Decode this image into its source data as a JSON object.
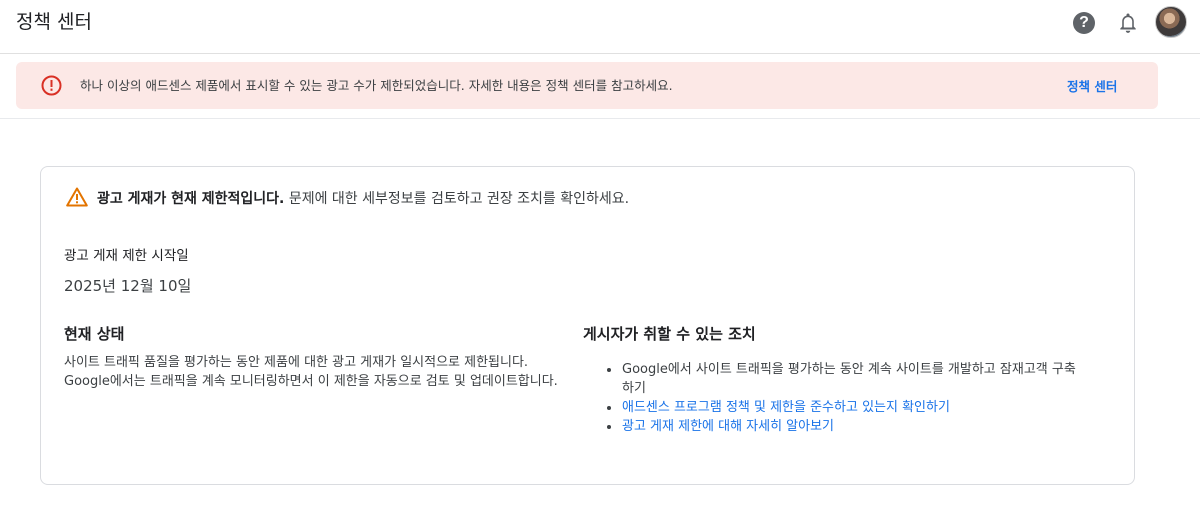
{
  "header": {
    "title": "정책 센터",
    "help_icon_glyph": "?"
  },
  "alert": {
    "message": "하나 이상의 애드센스 제품에서 표시할 수 있는 광고 수가 제한되었습니다. 자세한 내용은 정책 센터를 참고하세요.",
    "link_label": "정책 센터"
  },
  "card": {
    "warning_bold": "광고 게재가 현재 제한적입니다.",
    "warning_rest": " 문제에 대한 세부정보를 검토하고 권장 조치를 확인하세요.",
    "date_label": "광고 게재 제한 시작일",
    "date_value": "2025년 12월 10일",
    "status": {
      "heading": "현재 상태",
      "body": "사이트 트래픽 품질을 평가하는 동안 제품에 대한 광고 게재가 일시적으로 제한됩니다. Google에서는 트래픽을 계속 모니터링하면서 이 제한을 자동으로 검토 및 업데이트합니다."
    },
    "actions": {
      "heading": "게시자가 취할 수 있는 조치",
      "items": [
        {
          "text": "Google에서 사이트 트래픽을 평가하는 동안 계속 사이트를 개발하고 잠재고객 구축하기",
          "is_link": false
        },
        {
          "text": "애드센스 프로그램 정책 및 제한을 준수하고 있는지 확인하기",
          "is_link": true
        },
        {
          "text": "광고 게재 제한에 대해 자세히 알아보기",
          "is_link": true
        }
      ]
    }
  },
  "colors": {
    "alert_background": "#fce8e6",
    "error_red": "#d93025",
    "warning_orange": "#e37400",
    "link_blue": "#1a73e8"
  },
  "icons": [
    "help-icon",
    "bell-icon",
    "error-circle-icon",
    "warning-triangle-icon"
  ]
}
